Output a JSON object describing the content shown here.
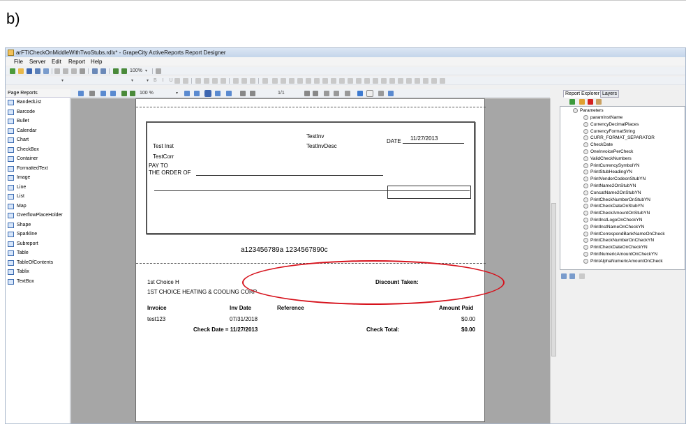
{
  "figure_label": "b)",
  "window": {
    "title": "arFTICheckOnMiddleWithTwoStubs.rdlx* - GrapeCity ActiveReports Report Designer"
  },
  "menu": [
    "File",
    "Server",
    "Edit",
    "Report",
    "Help"
  ],
  "toolbar1": {
    "zoom": "100%"
  },
  "toolbar2": {
    "font_tools": "B I U"
  },
  "canvas_toolbar": {
    "zoom": "100 %",
    "page_indicator": "1/1"
  },
  "left_panel": {
    "title": "Page Reports",
    "items": [
      {
        "label": "BandedList",
        "icon": "banded-list-icon"
      },
      {
        "label": "Barcode",
        "icon": "barcode-icon"
      },
      {
        "label": "Bullet",
        "icon": "bullet-icon"
      },
      {
        "label": "Calendar",
        "icon": "calendar-icon"
      },
      {
        "label": "Chart",
        "icon": "chart-icon"
      },
      {
        "label": "CheckBox",
        "icon": "checkbox-icon"
      },
      {
        "label": "Container",
        "icon": "container-icon"
      },
      {
        "label": "FormattedText",
        "icon": "formatted-text-icon"
      },
      {
        "label": "Image",
        "icon": "image-icon"
      },
      {
        "label": "Line",
        "icon": "line-icon"
      },
      {
        "label": "List",
        "icon": "list-icon"
      },
      {
        "label": "Map",
        "icon": "map-icon"
      },
      {
        "label": "OverflowPlaceHolder",
        "icon": "overflow-placeholder-icon"
      },
      {
        "label": "Shape",
        "icon": "shape-icon"
      },
      {
        "label": "Sparkline",
        "icon": "sparkline-icon"
      },
      {
        "label": "Subreport",
        "icon": "subreport-icon"
      },
      {
        "label": "Table",
        "icon": "table-icon"
      },
      {
        "label": "TableOfContents",
        "icon": "table-of-contents-icon"
      },
      {
        "label": "Tablix",
        "icon": "tablix-icon"
      },
      {
        "label": "TextBox",
        "icon": "textbox-icon"
      }
    ]
  },
  "check": {
    "inst_name": "Test Inst",
    "corr": "TestCorr",
    "inv": "TestInv",
    "inv_desc": "TestInvDesc",
    "date_label": "DATE",
    "date_value": "11/27/2013",
    "pay_to": "PAY TO",
    "order_of": "THE ORDER OF",
    "micr": "a123456789a 1234567890c"
  },
  "stub": {
    "vendor_short": "1st Choice H",
    "vendor_full": "1ST CHOICE HEATING & COOLING CORP",
    "discount_label": "Discount Taken:",
    "headers": {
      "invoice": "Invoice",
      "inv_date": "Inv Date",
      "reference": "Reference",
      "amount_paid": "Amount Paid"
    },
    "row": {
      "invoice": "test123",
      "inv_date": "07/31/2018",
      "amount": "$0.00"
    },
    "check_date_label": "Check Date = 11/27/2013",
    "check_total_label": "Check Total:",
    "check_total": "$0.00"
  },
  "right_panel": {
    "tabs": [
      "Report Explorer",
      "Layers"
    ],
    "root": "Parameters",
    "parameters": [
      "paramInstName",
      "CurrencyDecimalPlaces",
      "CurrencyFormatString",
      "CURR_FORMAT_SEPARATOR",
      "CheckDate",
      "OneInvoicePerCheck",
      "ValidCheckNumbers",
      "PrintCurrencySymbolYN",
      "PrintStubHeadingYN",
      "PrintVendorCodeonStubYN",
      "PrintName2OnStubYN",
      "ConcatName2OnStubYN",
      "PrintCheckNumberOnStubYN",
      "PrintCheckDateOnStubYN",
      "PrintCheckAmountOnStubYN",
      "PrintInstLogoOnCheckYN",
      "PrintInstNameOnCheckYN",
      "PrintCorrespondBankNameOnCheck",
      "PrintCheckNumberOnCheckYN",
      "PrintCheckDateOnCheckYN",
      "PrintNumericAmountOnCheckYN",
      "PrintAlphaNumericAmountOnCheck"
    ]
  },
  "colors": {
    "highlight": "#d6121c",
    "canvas": "#a6a6a6"
  }
}
